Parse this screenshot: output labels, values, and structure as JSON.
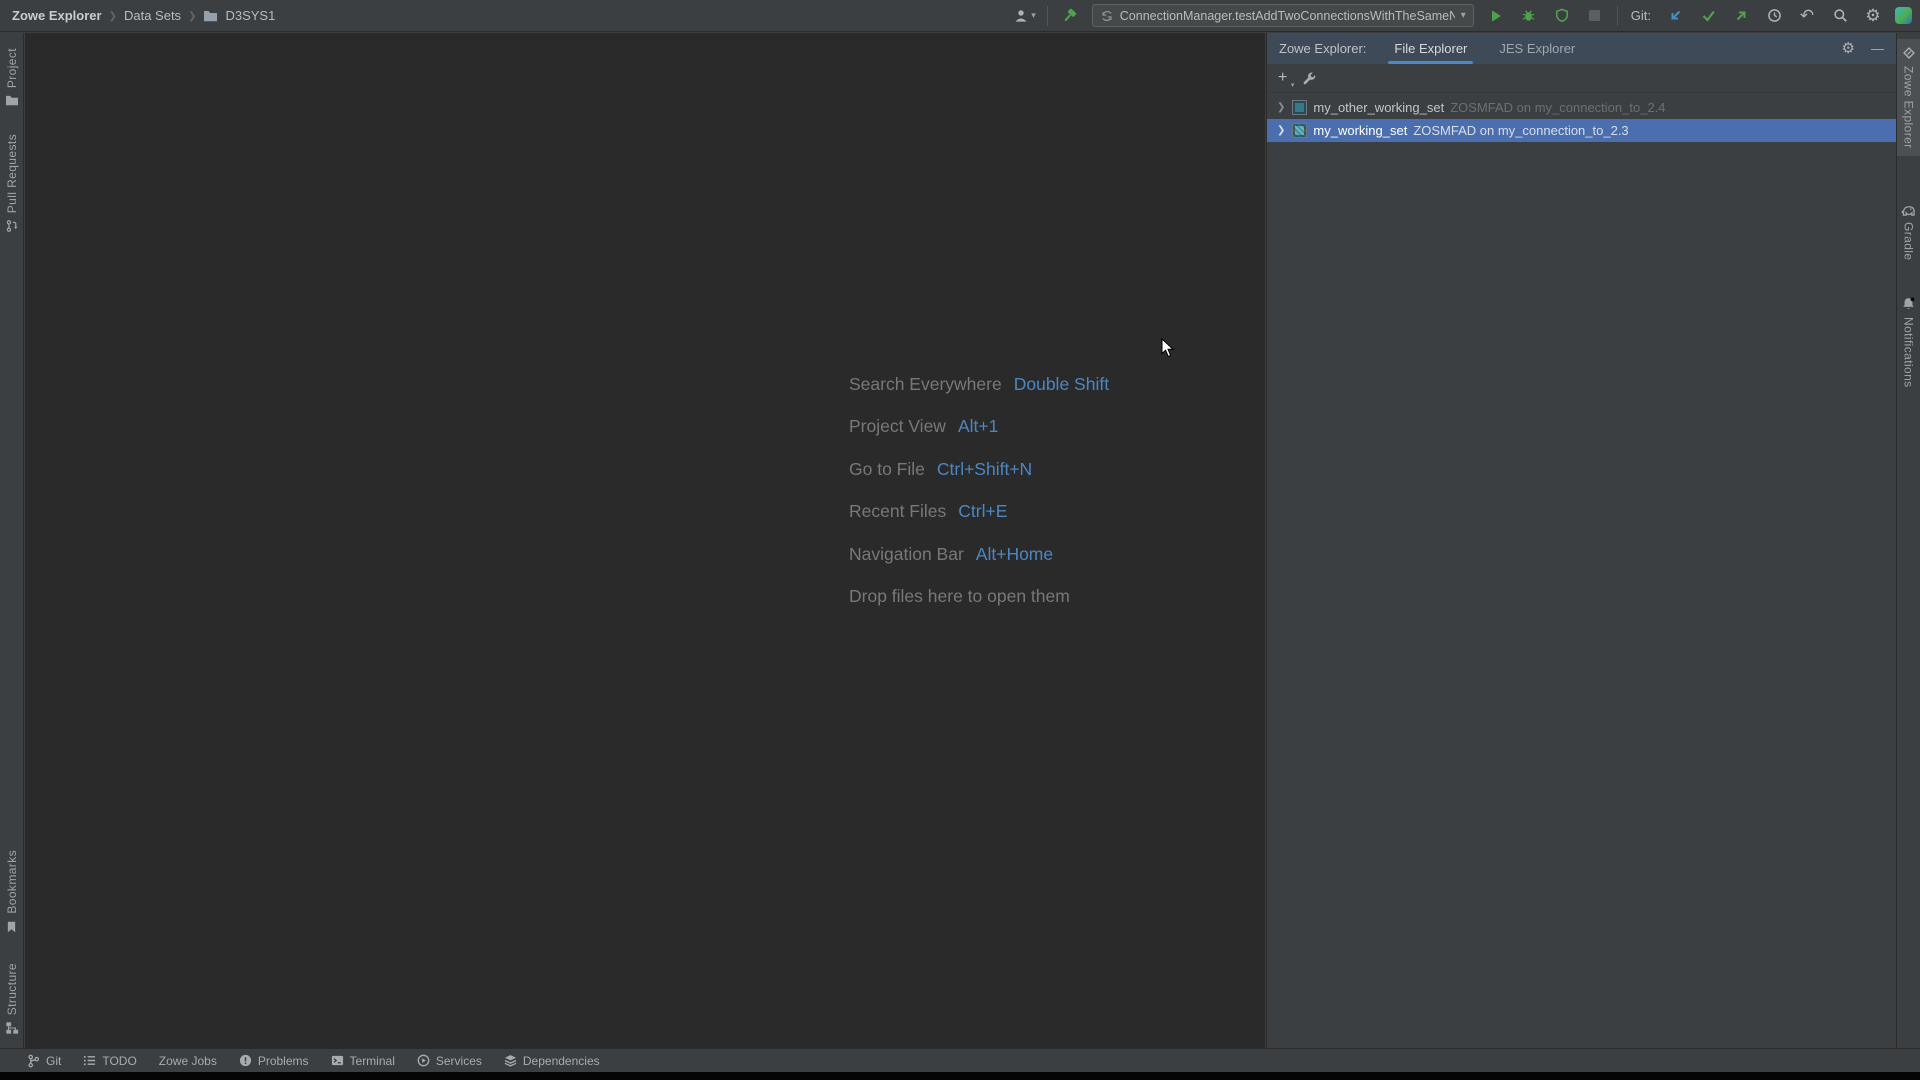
{
  "icons": {
    "breadcrumb_sep": "❯",
    "dropdown_arrow": "▾",
    "gear": "⚙",
    "minimize": "—",
    "plus": "+",
    "tree_chevron": "❯",
    "undo": "↶"
  },
  "topbar": {
    "breadcrumb": {
      "root": "Zowe Explorer",
      "section": "Data Sets",
      "item": "D3SYS1"
    },
    "run_config": "ConnectionManager.testAddTwoConnectionsWithTheSameName",
    "git_label": "Git:"
  },
  "left_stripe": {
    "project": "Project",
    "pull_requests": "Pull Requests",
    "bookmarks": "Bookmarks",
    "structure": "Structure"
  },
  "right_stripe": {
    "zowe": "Zowe Explorer",
    "gradle": "Gradle",
    "notifications": "Notifications"
  },
  "panel": {
    "title": "Zowe Explorer:",
    "tab_file": "File Explorer",
    "tab_jes": "JES Explorer",
    "tree": [
      {
        "name": "my_other_working_set",
        "detail": "ZOSMFAD on my_connection_to_2.4",
        "selected": false
      },
      {
        "name": "my_working_set",
        "detail": "ZOSMFAD on my_connection_to_2.3",
        "selected": true
      }
    ]
  },
  "shortcuts": [
    {
      "label": "Search Everywhere",
      "keys": "Double Shift"
    },
    {
      "label": "Project View",
      "keys": "Alt+1"
    },
    {
      "label": "Go to File",
      "keys": "Ctrl+Shift+N"
    },
    {
      "label": "Recent Files",
      "keys": "Ctrl+E"
    },
    {
      "label": "Navigation Bar",
      "keys": "Alt+Home"
    },
    {
      "label": "Drop files here to open them",
      "keys": ""
    }
  ],
  "statusbar": {
    "items": [
      {
        "label": "Git"
      },
      {
        "label": "TODO"
      },
      {
        "label": "Zowe Jobs"
      },
      {
        "label": "Problems"
      },
      {
        "label": "Terminal"
      },
      {
        "label": "Services"
      },
      {
        "label": "Dependencies"
      }
    ]
  },
  "colors": {
    "accent_blue": "#4A88C7",
    "selection_blue": "#4B6EAF",
    "run_green": "#4EA24E",
    "git_update_blue": "#3B92C8"
  }
}
